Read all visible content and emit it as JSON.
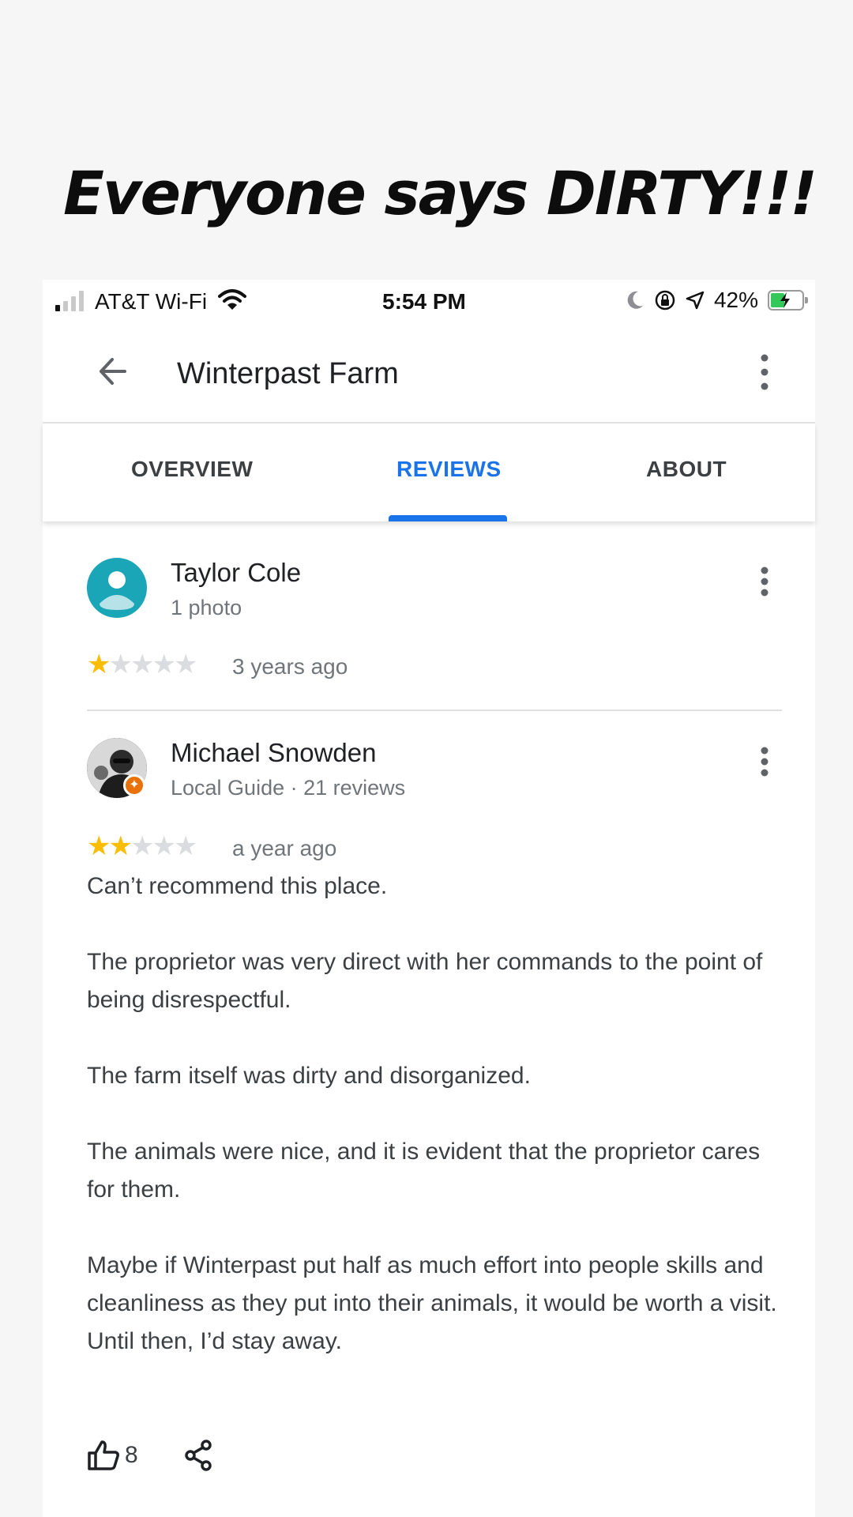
{
  "overlay": {
    "headline": "Everyone says DIRTY!!!"
  },
  "status_bar": {
    "carrier": "AT&T Wi-Fi",
    "time": "5:54 PM",
    "battery_percent": "42%",
    "icons": [
      "signal-icon",
      "wifi-icon",
      "moon-icon",
      "orientation-lock-icon",
      "location-icon",
      "battery-charging-icon"
    ]
  },
  "app_bar": {
    "title": "Winterpast Farm",
    "back_icon": "back-arrow-icon",
    "menu_icon": "more-vert-icon"
  },
  "tabs": [
    {
      "label": "OVERVIEW",
      "active": false
    },
    {
      "label": "REVIEWS",
      "active": true
    },
    {
      "label": "ABOUT",
      "active": false
    }
  ],
  "reviews": [
    {
      "name": "Taylor Cole",
      "subtitle": "1 photo",
      "rating": 1,
      "max_rating": 5,
      "time": "3 years ago",
      "text": []
    },
    {
      "name": "Michael Snowden",
      "subtitle": "Local Guide · 21 reviews",
      "rating": 2,
      "max_rating": 5,
      "time": "a year ago",
      "text": [
        "Can’t recommend this place.",
        "The proprietor was very direct with her commands to the point of being disrespectful.",
        "The farm itself was dirty and disorganized.",
        "The animals were nice, and it is evident that the proprietor cares for them.",
        "Maybe if Winterpast put half as much effort into people skills and cleanliness as they put into their animals, it would be worth a visit. Until then, I’d stay away."
      ],
      "like_count": "8"
    }
  ],
  "colors": {
    "accent": "#1a73e8",
    "star": "#fbbc04",
    "star_empty": "#dadce0",
    "battery": "#34c759",
    "local_guide_badge": "#e8710a"
  }
}
